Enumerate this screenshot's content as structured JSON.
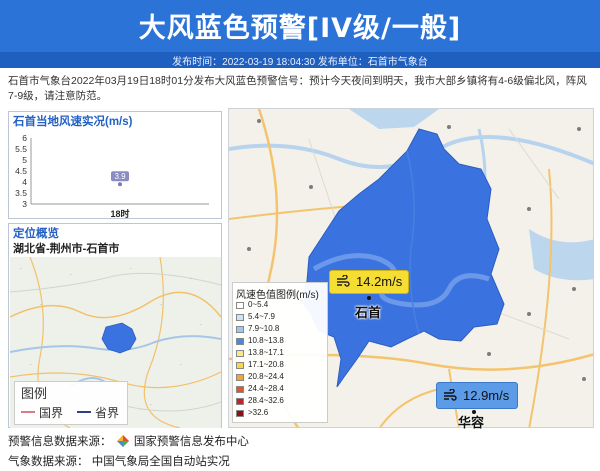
{
  "header": {
    "title": "大风蓝色预警[IV级/一般]",
    "meta_line": "发布时间：2022-03-19 18:04:30    发布单位：石首市气象台"
  },
  "description": "石首市气象台2022年03月19日18时01分发布大风蓝色预警信号：预计今天夜间到明天，我市大部乡镇将有4-6级偏北风，阵风7-9级，请注意防范。",
  "colors": {
    "header_bg": "#2b73d6",
    "accent": "#2361c4",
    "warning_blue": "#3a73e0",
    "badge_yellow": "#f5dd33",
    "badge_blue": "#5b9be8"
  },
  "chart_panel": {
    "title": "石首当地风速实况(m/s)"
  },
  "chart_data": {
    "type": "scatter",
    "title": "石首当地风速实况(m/s)",
    "categories": [
      "18时"
    ],
    "values": [
      3.9
    ],
    "data_labels": [
      "3.9"
    ],
    "ylim": [
      3,
      6
    ],
    "yticks": [
      "6",
      "5.5",
      "5",
      "4.5",
      "4",
      "3.5",
      "3"
    ],
    "grid": false
  },
  "location_panel": {
    "title": "定位概览",
    "path": "湖北省-荆州市-石首市",
    "legend": {
      "title": "图例",
      "items": [
        {
          "label": "国界",
          "color": "#d67d8c"
        },
        {
          "label": "省界",
          "color": "#2c3f8c"
        }
      ]
    }
  },
  "map": {
    "wind_legend": {
      "title": "风速色值图例(m/s)",
      "items": [
        {
          "label": "0~5.4",
          "color": "#ffffff"
        },
        {
          "label": "5.4~7.9",
          "color": "#cfe3f7"
        },
        {
          "label": "7.9~10.8",
          "color": "#9cc7ef"
        },
        {
          "label": "10.8~13.8",
          "color": "#4a86e6"
        },
        {
          "label": "13.8~17.1",
          "color": "#f8e98b"
        },
        {
          "label": "17.1~20.8",
          "color": "#f6d64a"
        },
        {
          "label": "20.8~24.4",
          "color": "#f3a43a"
        },
        {
          "label": "24.4~28.4",
          "color": "#e2552f"
        },
        {
          "label": "28.4~32.6",
          "color": "#c0242a"
        },
        {
          "label": ">32.6",
          "color": "#8a1118"
        }
      ]
    },
    "stations": [
      {
        "name": "石首",
        "wind": "14.2m/s",
        "wind_icon": "wind-icon",
        "badge_color": "#f5dd33"
      },
      {
        "name": "华容",
        "wind": "12.9m/s",
        "wind_icon": "wind-icon",
        "badge_color": "#5b9be8"
      }
    ]
  },
  "footer": {
    "source1_label": "预警信息数据来源：",
    "source1_logo": "warning-center-logo-icon",
    "source1_value": "国家预警信息发布中心",
    "source2_label": "气象数据来源：",
    "source2_value": "中国气象局全国自动站实况"
  }
}
